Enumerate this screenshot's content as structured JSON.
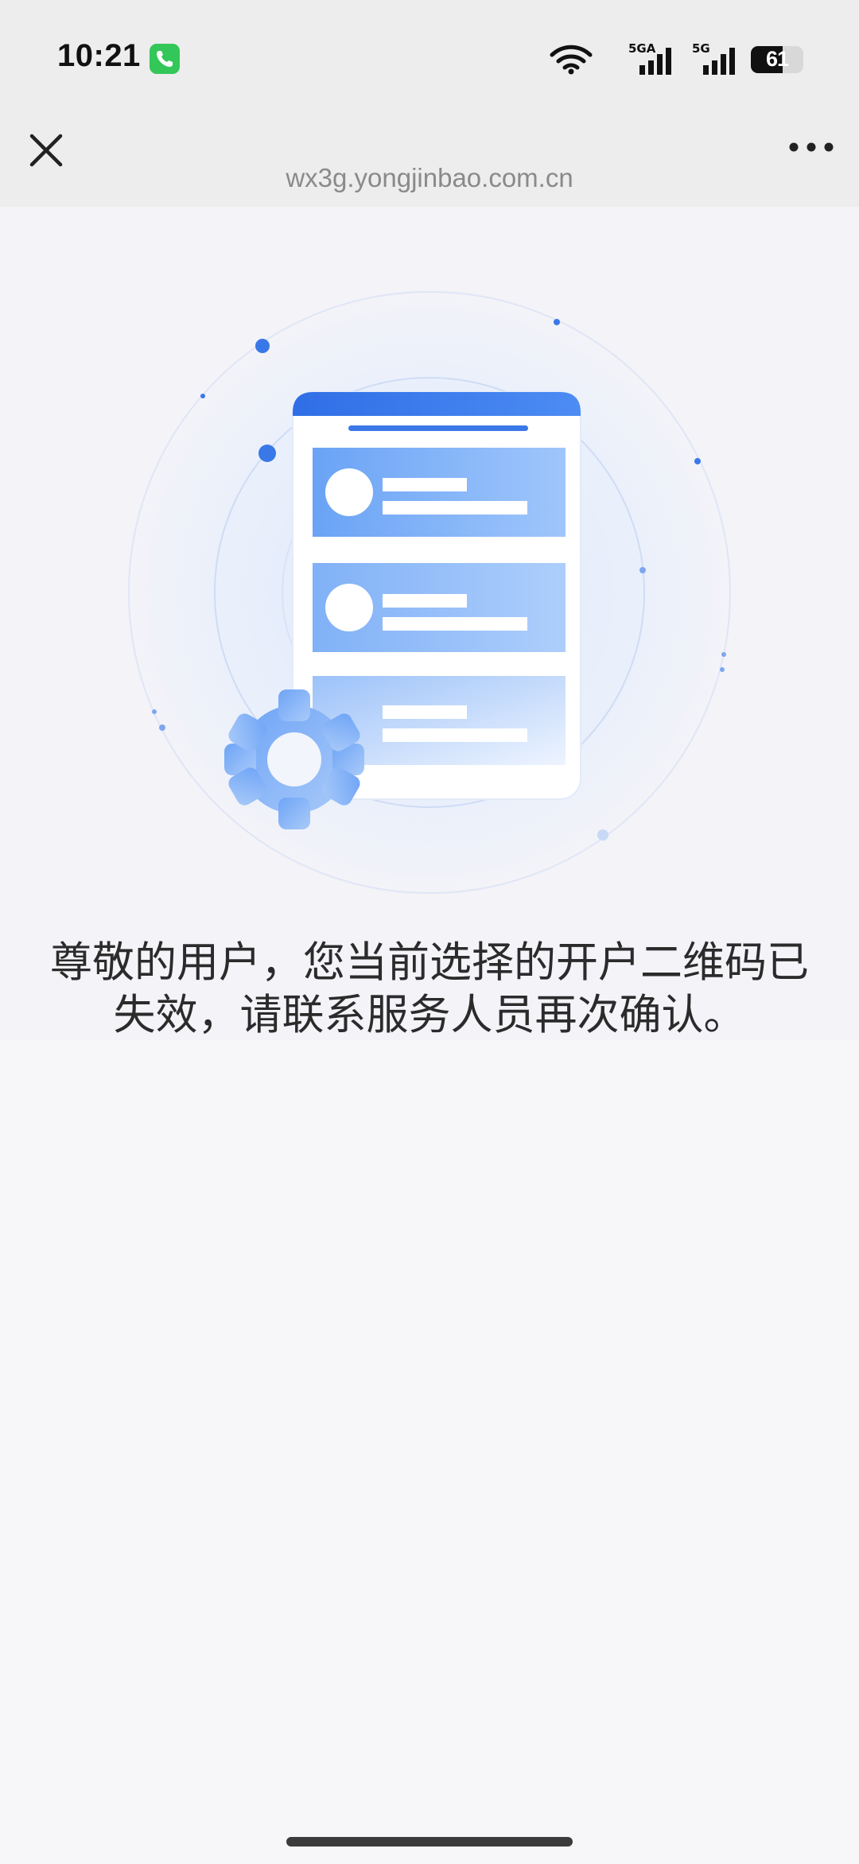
{
  "status_bar": {
    "time": "10:21",
    "network_1": "5GA",
    "network_2": "5G",
    "battery_level": 61,
    "battery_text": "61",
    "icons": [
      "phone-call-icon",
      "wifi-icon",
      "signal-icon",
      "signal-icon",
      "battery-icon"
    ]
  },
  "browser": {
    "url": "wx3g.yongjinbao.com.cn",
    "icons": [
      "close-icon",
      "more-icon"
    ]
  },
  "main": {
    "message": "尊敬的用户，您当前选择的开户二维码已失效，请联系服务人员再次确认。"
  },
  "colors": {
    "accent": "#3a78e8",
    "card_blue": "#7fb2f8",
    "background": "#f3f3f8"
  }
}
